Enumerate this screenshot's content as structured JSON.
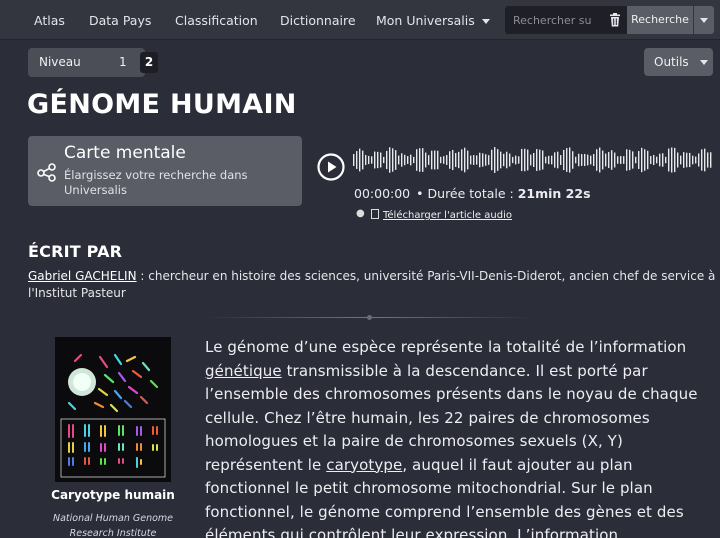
{
  "nav": {
    "items": [
      "Atlas",
      "Data Pays",
      "Classification",
      "Dictionnaire",
      "Mon Universalis"
    ],
    "search_placeholder": "Rechercher su",
    "search_button": "Recherche"
  },
  "level": {
    "label": "Niveau",
    "options": [
      "1",
      "2"
    ],
    "selected": "2"
  },
  "tools": {
    "label": "Outils"
  },
  "title": "GÉNOME HUMAIN",
  "mindmap": {
    "title": "Carte mentale",
    "description": "Élargissez votre recherche dans Universalis"
  },
  "audio": {
    "current_time": "00:00:00",
    "total_label": "Durée totale : ",
    "total_value": "21min 22s",
    "download_label": "Télécharger l'article audio"
  },
  "author": {
    "heading": "ÉCRIT PAR",
    "name": "Gabriel GACHELIN",
    "description": " : chercheur en histoire des sciences, université Paris-VII-Denis-Diderot, ancien chef de service à l'Institut Pasteur"
  },
  "figure": {
    "caption": "Caryotype humain",
    "credit": "National Human Genome Research Institute"
  },
  "article": {
    "p1_a": "Le génome d’une espèce représente la totalité de l’information ",
    "link_genetique": "génétique",
    "p1_b": " transmissible à la descendance. Il est porté par l’ensemble des chromosomes présents dans le noyau de chaque cellule. Chez l’être humain, les 22  paires de chromosomes homologues et la paire de chromosomes sexuels (X, Y) représentent le ",
    "link_caryotype": "caryotype",
    "p1_c": ", auquel il faut ajouter au plan fonctionnel le petit chromosome mitochondrial. Sur le plan fonctionnel, le génome comprend l’ensemble des gènes et des éléments qui contrôlent leur expression. L’information"
  },
  "colors": {
    "background": "#2b2d38",
    "nav": "#34363f",
    "panel": "#5a5c66"
  }
}
